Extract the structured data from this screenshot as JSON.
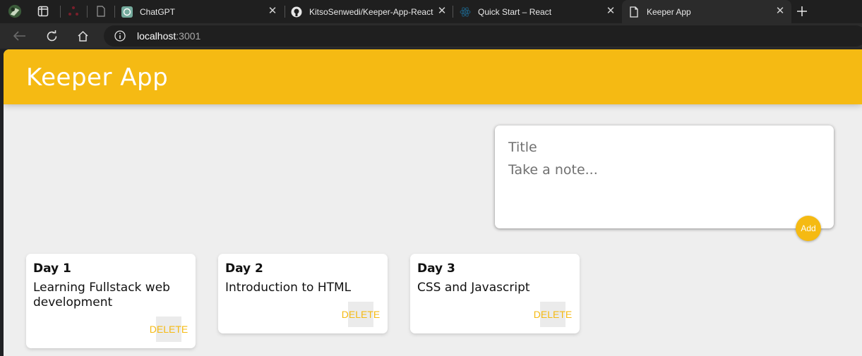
{
  "browser": {
    "tabs": [
      {
        "label": "ChatGPT",
        "icon": "chatgpt-icon",
        "active": false
      },
      {
        "label": "KitsoSenwedi/Keeper-App-React",
        "icon": "github-icon",
        "active": false
      },
      {
        "label": "Quick Start – React",
        "icon": "react-icon",
        "active": false
      },
      {
        "label": "Keeper App",
        "icon": "page-icon",
        "active": true
      }
    ],
    "address": {
      "host": "localhost",
      "port": ":3001"
    }
  },
  "app": {
    "title": "Keeper App",
    "accent_color": "#f5ba13",
    "create_note": {
      "title_placeholder": "Title",
      "content_placeholder": "Take a note...",
      "add_label": "Add"
    },
    "notes": [
      {
        "title": "Day 1",
        "content": "Learning Fullstack web development",
        "delete_label": "DELETE"
      },
      {
        "title": "Day 2",
        "content": "Introduction to HTML",
        "delete_label": "DELETE"
      },
      {
        "title": "Day 3",
        "content": "CSS and Javascript",
        "delete_label": "DELETE"
      }
    ]
  }
}
